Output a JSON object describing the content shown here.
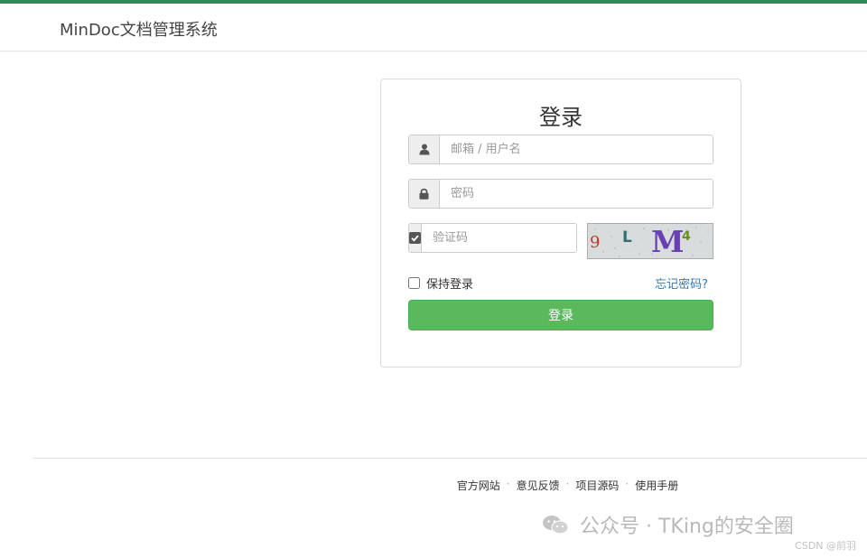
{
  "header": {
    "brand": "MinDoc文档管理系统"
  },
  "login": {
    "title": "登录",
    "username_placeholder": "邮箱 / 用户名",
    "password_placeholder": "密码",
    "captcha_placeholder": "验证码",
    "captcha_text": "9 L M4",
    "remember_label": "保持登录",
    "forgot_label": "忘记密码?",
    "submit_label": "登录"
  },
  "footer": {
    "links": [
      "官方网站",
      "意见反馈",
      "项目源码",
      "使用手册"
    ],
    "separator": "·"
  },
  "watermark": {
    "text": "公众号 · TKing的安全圈",
    "csdn": "CSDN @前羽"
  },
  "colors": {
    "accent_green": "#5cb85c",
    "top_bar": "#2e8b57",
    "link_blue": "#337ab7"
  }
}
